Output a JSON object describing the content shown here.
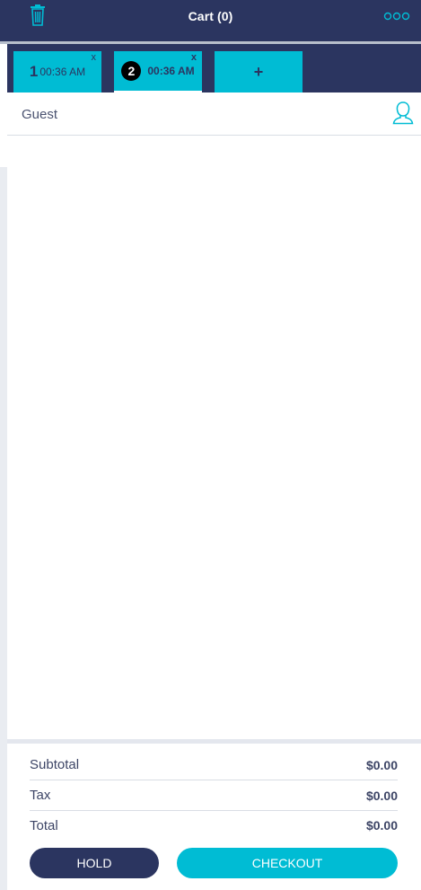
{
  "header": {
    "title": "Cart (0)",
    "trash_icon": "trash-icon",
    "more_icon": "more-dots-icon"
  },
  "tabs": [
    {
      "number": "1",
      "time": "00:36 AM",
      "close": "x",
      "active": false
    },
    {
      "number": "2",
      "time": "00:36 AM",
      "close": "x",
      "active": true
    }
  ],
  "add_tab": {
    "label": "+"
  },
  "guest": {
    "label": "Guest",
    "icon": "user-icon"
  },
  "totals": {
    "subtotal_label": "Subtotal",
    "subtotal_value": "$0.00",
    "tax_label": "Tax",
    "tax_value": "$0.00",
    "total_label": "Total",
    "total_value": "$0.00"
  },
  "actions": {
    "hold_label": "HOLD",
    "checkout_label": "CHECKOUT"
  },
  "colors": {
    "navy": "#2b3560",
    "cyan": "#00bcd4",
    "white": "#ffffff"
  }
}
